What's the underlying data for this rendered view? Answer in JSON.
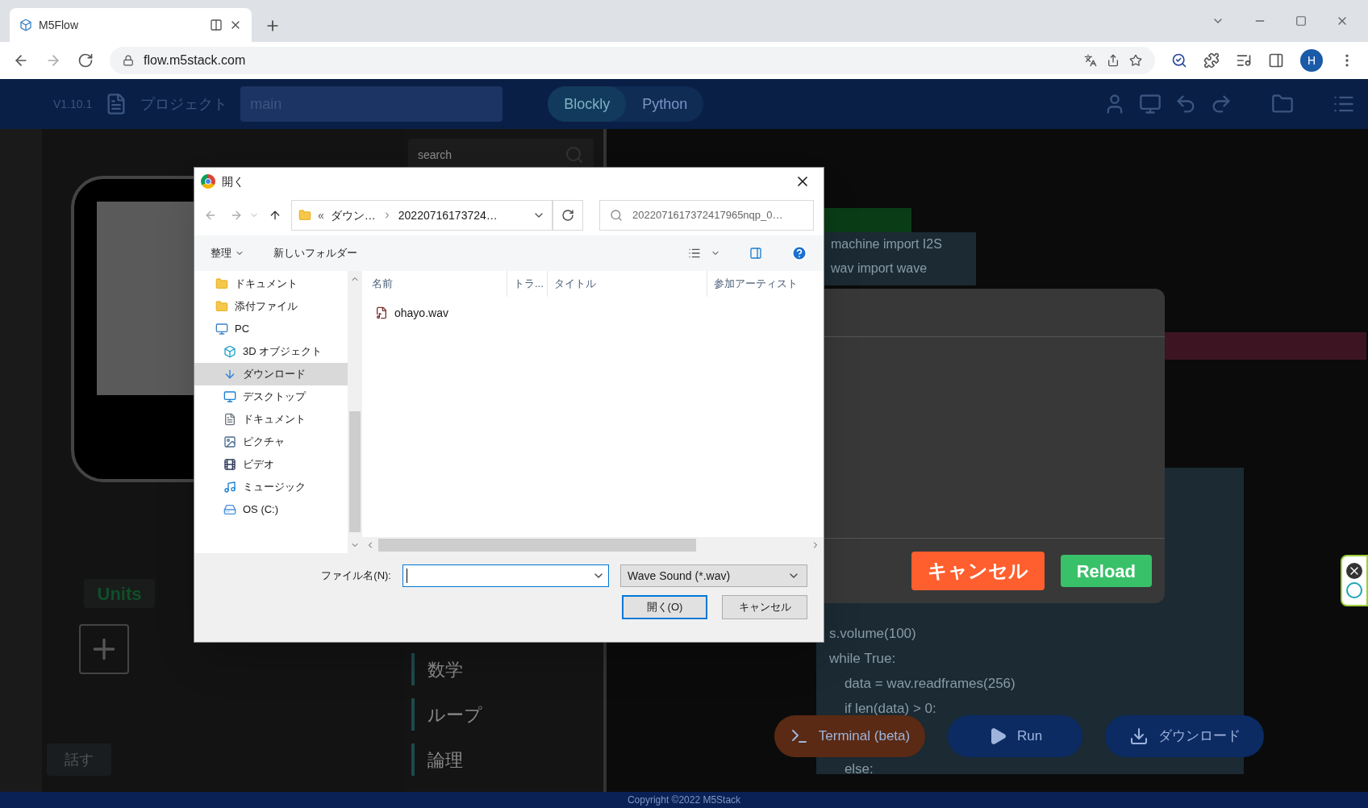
{
  "browser": {
    "tab_title": "M5Flow",
    "url": "flow.m5stack.com",
    "profile": "H"
  },
  "app": {
    "version": "V1.10.1",
    "project": "プロジェクト",
    "file": "main",
    "modes": [
      {
        "label": "Blockly",
        "selected": true
      },
      {
        "label": "Python",
        "selected": false
      }
    ],
    "search_placeholder": "search",
    "units": "Units",
    "speak": "話す",
    "categories": [
      "数学",
      "ループ",
      "論理"
    ],
    "code_lines": [
      "machine import I2S",
      "wav import wave"
    ],
    "code_lines_2": [
      "s.volume(100)",
      "while True:",
      "    data = wav.readframes(256)",
      "    if len(data) > 0:",
      "    else:"
    ],
    "actions": [
      {
        "label": "Terminal (beta)",
        "kind": "terminal"
      },
      {
        "label": "Run",
        "kind": "run"
      },
      {
        "label": "ダウンロード",
        "kind": "download"
      }
    ],
    "copyright": "Copyright ©2022 M5Stack"
  },
  "modal": {
    "buttons": [
      {
        "label": "キャンセル",
        "kind": "cancel"
      },
      {
        "label": "Reload",
        "kind": "reload"
      }
    ]
  },
  "dialog": {
    "title": "開く",
    "breadcrumb_prefix": "«",
    "breadcrumb": [
      "ダウン…",
      "20220716173724…"
    ],
    "search": {
      "placeholder": "2022071617372417965nqp_0…"
    },
    "toolbar": [
      "整理",
      "新しいフォルダー"
    ],
    "nav": [
      {
        "label": "ドキュメント",
        "kind": "folder",
        "selected": false
      },
      {
        "label": "添付ファイル",
        "kind": "folder",
        "selected": false
      },
      {
        "label": "PC",
        "kind": "pc",
        "selected": false,
        "children": [
          {
            "label": "3D オブジェクト",
            "kind": "cube",
            "selected": false
          },
          {
            "label": "ダウンロード",
            "kind": "download",
            "selected": true
          },
          {
            "label": "デスクトップ",
            "kind": "desktop",
            "selected": false
          },
          {
            "label": "ドキュメント",
            "kind": "document",
            "selected": false
          },
          {
            "label": "ピクチャ",
            "kind": "picture",
            "selected": false
          },
          {
            "label": "ビデオ",
            "kind": "video",
            "selected": false
          },
          {
            "label": "ミュージック",
            "kind": "music",
            "selected": false
          },
          {
            "label": "OS (C:)",
            "kind": "drive",
            "selected": false
          }
        ]
      }
    ],
    "columns": [
      "名前",
      "トラ...",
      "タイトル",
      "参加アーティスト"
    ],
    "files": [
      "ohayo.wav"
    ],
    "filename_label": "ファイル名(N):",
    "filetype": "Wave Sound (*.wav)",
    "buttons": [
      {
        "label": "開く(O)",
        "kind": "primary"
      },
      {
        "label": "キャンセル",
        "kind": "secondary"
      }
    ]
  }
}
